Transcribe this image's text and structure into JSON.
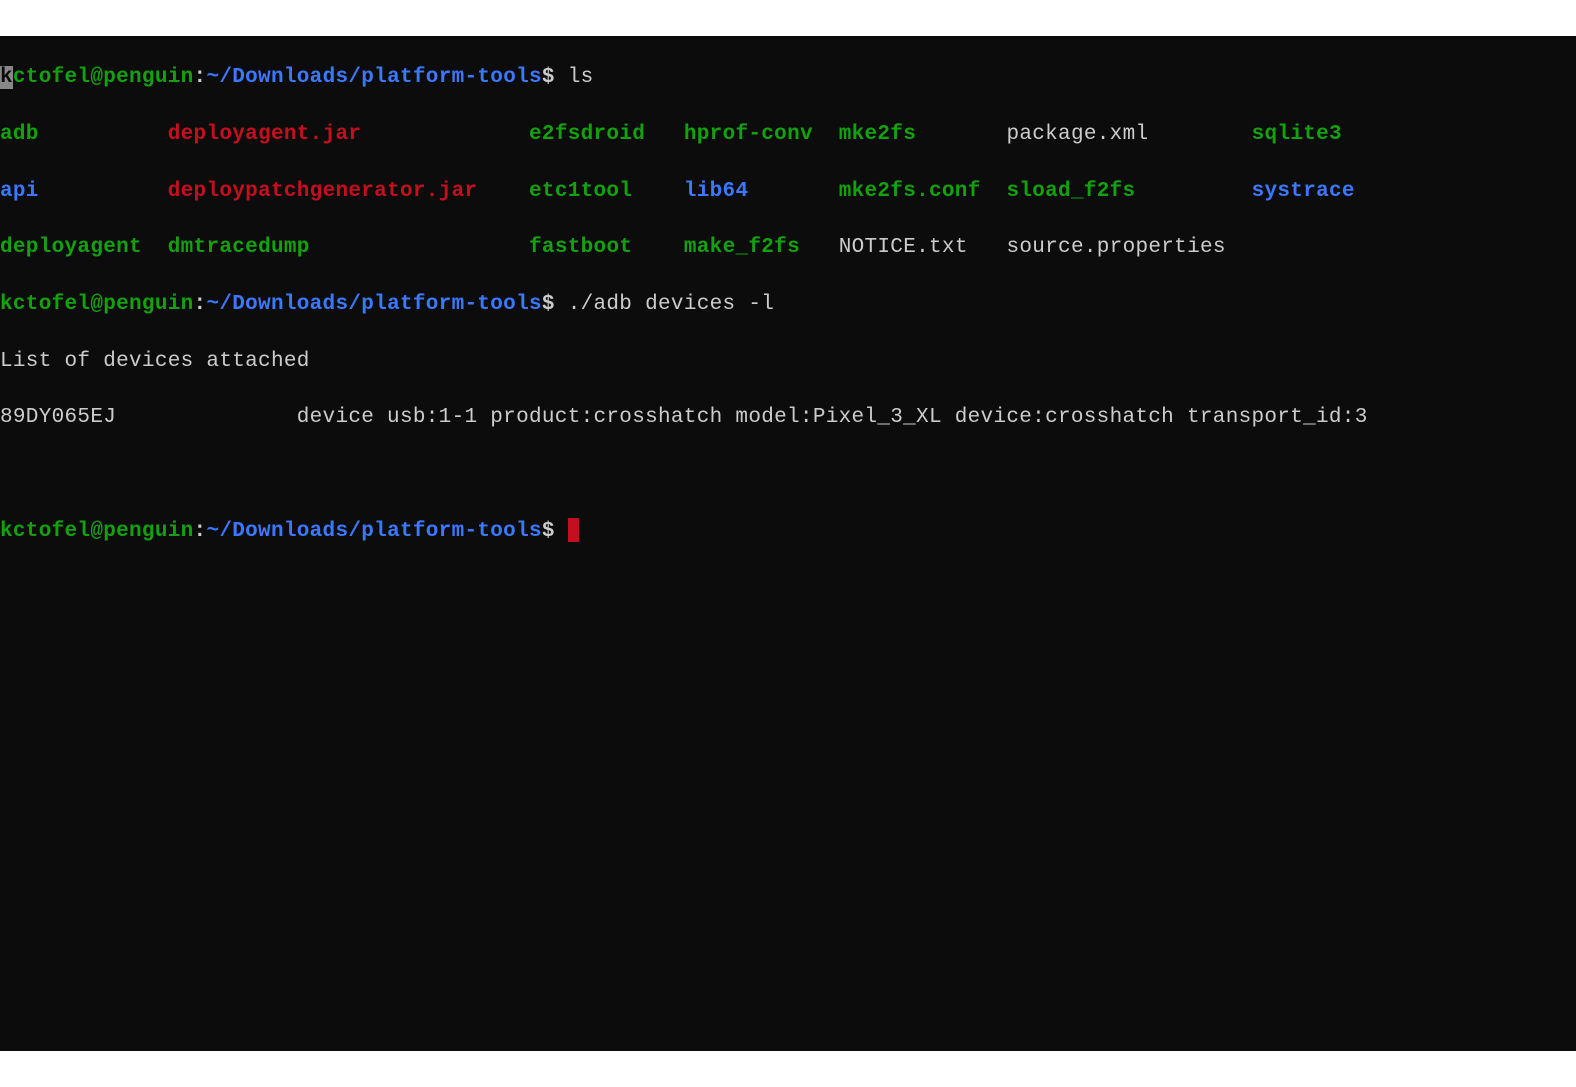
{
  "prompt": {
    "user_host": "kctofel@penguin",
    "sep": ":",
    "path": "~/Downloads/platform-tools",
    "dollar": "$",
    "first_char_sel": "k",
    "rest_user_host": "ctofel@penguin"
  },
  "commands": {
    "cmd1": " ls",
    "cmd2": " ./adb devices -l",
    "cmd3": " "
  },
  "ls_output": {
    "row1": {
      "c1": "adb",
      "c2": "deployagent.jar",
      "c3": "e2fsdroid",
      "c4": "hprof-conv",
      "c5": "mke2fs",
      "c6": "package.xml",
      "c7": "sqlite3"
    },
    "row2": {
      "c1": "api",
      "c2": "deploypatchgenerator.jar",
      "c3": "etc1tool",
      "c4": "lib64",
      "c5": "mke2fs.conf",
      "c6": "sload_f2fs",
      "c7": "systrace"
    },
    "row3": {
      "c1": "deployagent",
      "c2": "dmtracedump",
      "c3": "fastboot",
      "c4": "make_f2fs",
      "c5": "NOTICE.txt",
      "c6": "source.properties"
    }
  },
  "adb_output": {
    "header": "List of devices attached",
    "device_line": "89DY065EJ              device usb:1-1 product:crosshatch model:Pixel_3_XL device:crosshatch transport_id:3"
  },
  "spacing": {
    "r1c1": "          ",
    "r1c2": "             ",
    "r1c3": "   ",
    "r1c4": "  ",
    "r1c5": "       ",
    "r1c6": "        ",
    "r2c1": "          ",
    "r2c2": "    ",
    "r2c3": "    ",
    "r2c4": "       ",
    "r2c5": "  ",
    "r2c6": "         ",
    "r3c1": "  ",
    "r3c2": "                 ",
    "r3c3": "    ",
    "r3c4": "   ",
    "r3c5": "   ",
    "r3c6": "  "
  }
}
